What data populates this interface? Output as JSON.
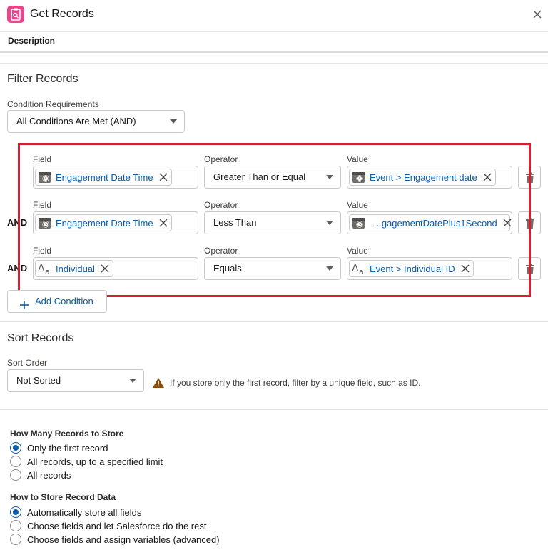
{
  "header": {
    "title": "Get Records",
    "description_label": "Description"
  },
  "filter": {
    "section_title": "Filter Records",
    "condition_req_label": "Condition Requirements",
    "condition_req_value": "All Conditions Are Met (AND)",
    "conditions": [
      {
        "connector": "",
        "field_label": "Field",
        "field": "Engagement Date Time",
        "field_icon": "calendar-clock-icon",
        "operator_label": "Operator",
        "operator": "Greater Than or Equal",
        "value_label": "Value",
        "value": "Event > Engagement date",
        "value_icon": "calendar-clock-icon"
      },
      {
        "connector": "AND",
        "field_label": "Field",
        "field": "Engagement Date Time",
        "field_icon": "calendar-clock-icon",
        "operator_label": "Operator",
        "operator": "Less Than",
        "value_label": "Value",
        "value": "...gagementDatePlus1Second",
        "value_icon": "calendar-clock-icon"
      },
      {
        "connector": "AND",
        "field_label": "Field",
        "field": "Individual",
        "field_icon": "text-aa-icon",
        "operator_label": "Operator",
        "operator": "Equals",
        "value_label": "Value",
        "value": "Event > Individual ID",
        "value_icon": "text-aa-icon"
      }
    ],
    "add_condition_label": "Add Condition"
  },
  "sort": {
    "section_title": "Sort Records",
    "order_label": "Sort Order",
    "order_value": "Not Sorted",
    "warning_text": "If you store only the first record, filter by a unique field, such as ID."
  },
  "store_count": {
    "label": "How Many Records to Store",
    "options": [
      "Only the first record",
      "All records, up to a specified limit",
      "All records"
    ],
    "selected_index": 0
  },
  "store_data": {
    "label": "How to Store Record Data",
    "options": [
      "Automatically store all fields",
      "Choose fields and let Salesforce do the rest",
      "Choose fields and assign variables (advanced)"
    ],
    "selected_index": 0
  },
  "colors": {
    "accent": "#0b5cab",
    "highlight_border": "#d5212f",
    "app_icon": "#e7478a",
    "warning": "#8c4b02"
  }
}
